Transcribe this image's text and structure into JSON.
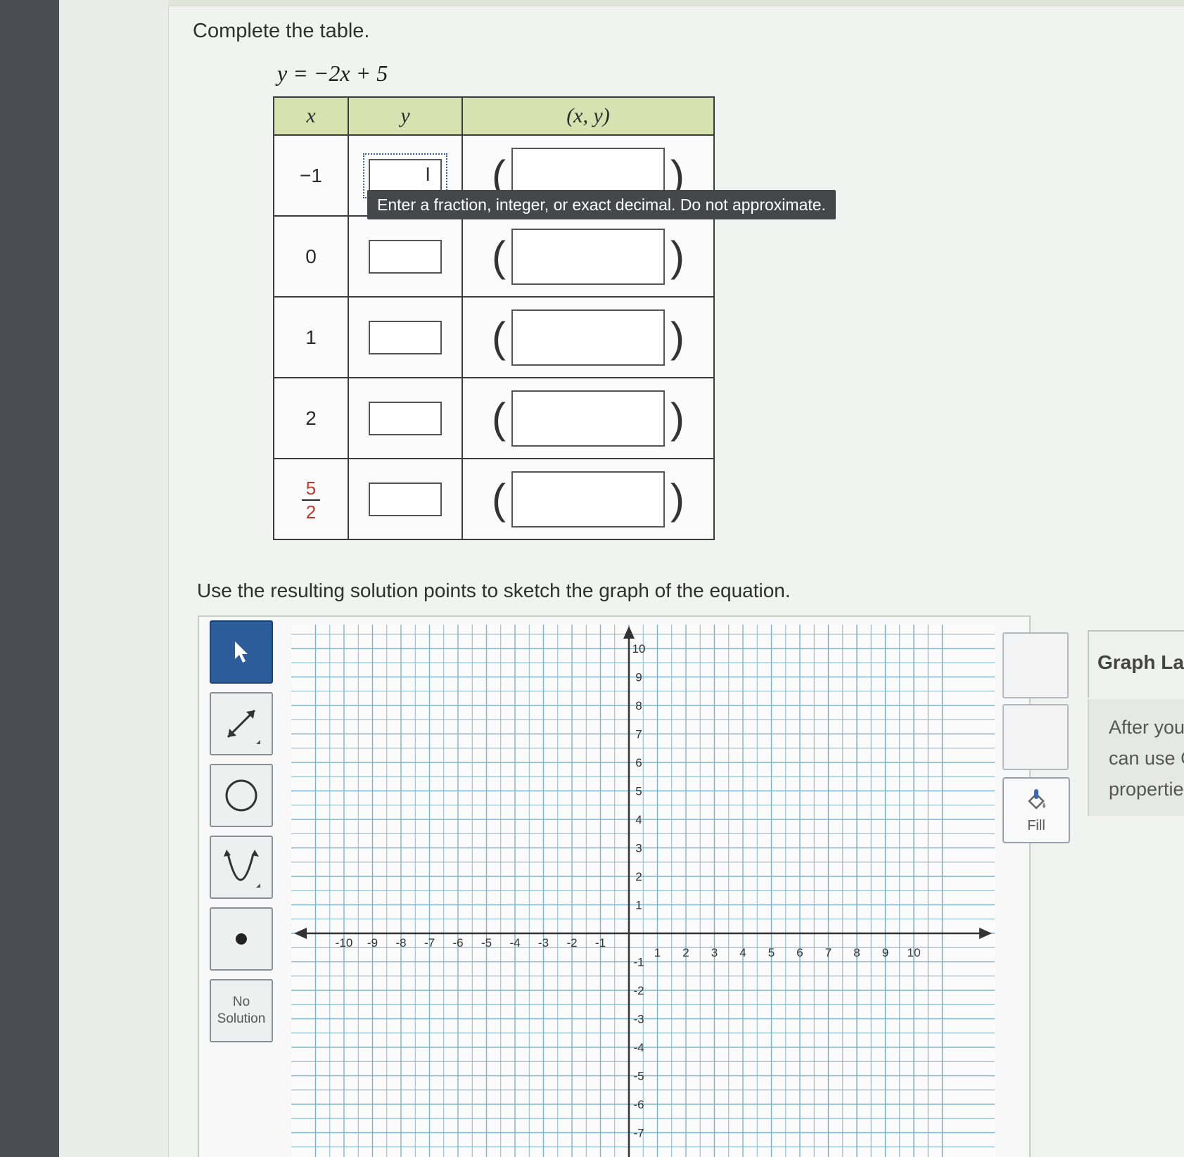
{
  "instructions": {
    "complete_table": "Complete the table.",
    "equation": "y = −2x + 5",
    "sketch": "Use the resulting solution points to sketch the graph of the equation."
  },
  "table": {
    "headers": [
      "x",
      "y",
      "(x, y)"
    ],
    "rows": [
      {
        "x": "−1",
        "y": "",
        "point": ""
      },
      {
        "x": "0",
        "y": "",
        "point": ""
      },
      {
        "x": "1",
        "y": "",
        "point": ""
      },
      {
        "x": "2",
        "y": "",
        "point": ""
      },
      {
        "x_num": "5",
        "x_den": "2",
        "y": "",
        "point": ""
      }
    ]
  },
  "tooltip": "Enter a fraction, integer, or exact decimal. Do not approximate.",
  "tools": {
    "select_icon": "pointer-arrow-icon",
    "line_icon": "line-tool-icon",
    "circle_icon": "circle-tool-icon",
    "parabola_icon": "parabola-tool-icon",
    "point_icon": "point-tool-icon",
    "no_solution_line1": "No",
    "no_solution_line2": "Solution"
  },
  "fill": {
    "label": "Fill",
    "icon": "paint-bucket-icon"
  },
  "graph_layers": {
    "title": "Graph Layers",
    "text_line1": "After you add a",
    "text_line2": "can use Graph",
    "text_line3": "properties."
  },
  "graph": {
    "x_ticks": [
      "-10",
      "-9",
      "-8",
      "-7",
      "-6",
      "-5",
      "-4",
      "-3",
      "-2",
      "-1",
      "1",
      "2",
      "3",
      "4",
      "5",
      "6",
      "7",
      "8",
      "9",
      "10"
    ],
    "y_ticks_pos": [
      "10",
      "9",
      "8",
      "7",
      "6",
      "5",
      "4",
      "3",
      "2",
      "1"
    ],
    "y_ticks_neg": [
      "-1",
      "-2",
      "-3",
      "-4",
      "-5",
      "-6",
      "-7"
    ],
    "x_range": [
      -10,
      10
    ],
    "y_range_visible": [
      -7,
      10
    ],
    "grid": true,
    "colors": {
      "grid": "#7fb3c8",
      "axis": "#333333",
      "selected_tool": "#2c5c9a",
      "header": "#d8e2b0"
    }
  }
}
